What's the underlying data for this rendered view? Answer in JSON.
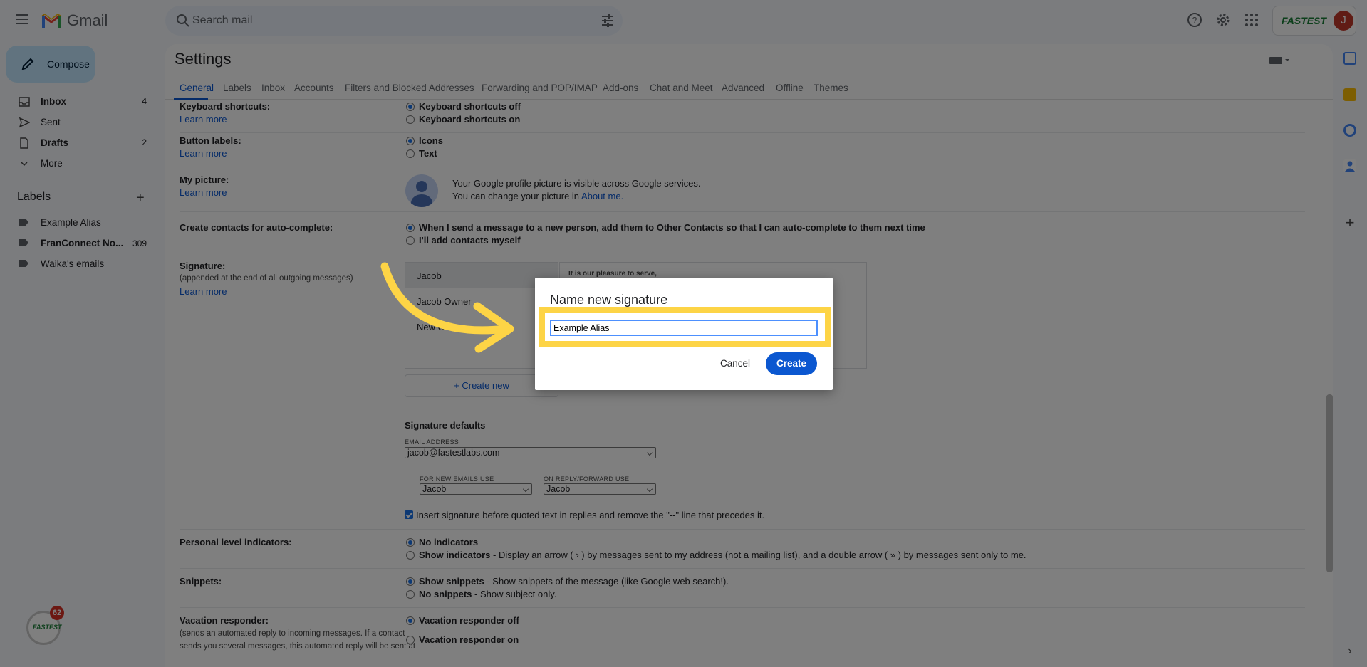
{
  "header": {
    "app_name": "Gmail",
    "search_placeholder": "Search mail",
    "brand_badge": "FASTEST"
  },
  "avatar_letter": "J",
  "nav": {
    "compose": "Compose",
    "items": [
      {
        "label": "Inbox",
        "count": "4",
        "icon": "inbox-icon"
      },
      {
        "label": "Sent",
        "count": "",
        "icon": "send-icon"
      },
      {
        "label": "Drafts",
        "count": "2",
        "icon": "draft-icon"
      },
      {
        "label": "More",
        "count": "",
        "icon": "chevron-down-icon"
      }
    ],
    "labels_header": "Labels",
    "labels": [
      {
        "label": "Example Alias",
        "count": ""
      },
      {
        "label": "FranConnect No...",
        "count": "309"
      },
      {
        "label": "Waika's emails",
        "count": ""
      }
    ],
    "float_badge_count": "62",
    "float_badge_brand": "FASTEST"
  },
  "settings": {
    "title": "Settings",
    "tabs": [
      "General",
      "Labels",
      "Inbox",
      "Accounts",
      "Filters and Blocked Addresses",
      "Forwarding and POP/IMAP",
      "Add-ons",
      "Chat and Meet",
      "Advanced",
      "Offline",
      "Themes"
    ],
    "learn_more": "Learn more",
    "keyboard": {
      "title": "Keyboard shortcuts:",
      "opt1": "Keyboard shortcuts off",
      "opt2": "Keyboard shortcuts on"
    },
    "button_labels": {
      "title": "Button labels:",
      "opt1": "Icons",
      "opt2": "Text"
    },
    "picture": {
      "title": "My picture:",
      "line1": "Your Google profile picture is visible across Google services.",
      "line2_pre": "You can change your picture in ",
      "line2_link": "About me."
    },
    "contacts": {
      "title": "Create contacts for auto-complete:",
      "opt1": "When I send a message to a new person, add them to Other Contacts so that I can auto-complete to them next time",
      "opt2": "I'll add contacts myself"
    },
    "signature": {
      "title": "Signature:",
      "sub": "(appended at the end of all outgoing messages)",
      "list": [
        "Jacob",
        "Jacob Owner",
        "New Cente"
      ],
      "editor_text": "It is our pleasure to serve,",
      "create_new": "Create new",
      "defaults_title": "Signature defaults",
      "email_address_label": "EMAIL ADDRESS",
      "email_address": "jacob@fastestlabs.com",
      "new_emails_label": "FOR NEW EMAILS USE",
      "new_emails_value": "Jacob",
      "reply_label": "ON REPLY/FORWARD USE",
      "reply_value": "Jacob",
      "insert_text": "Insert signature before quoted text in replies and remove the \"--\" line that precedes it."
    },
    "personal": {
      "title": "Personal level indicators:",
      "opt1": "No indicators",
      "opt2_b": "Show indicators",
      "opt2_rest": " - Display an arrow ( › ) by messages sent to my address (not a mailing list), and a double arrow ( » ) by messages sent only to me."
    },
    "snippets": {
      "title": "Snippets:",
      "opt1_b": "Show snippets",
      "opt1_rest": " - Show snippets of the message (like Google web search!).",
      "opt2_b": "No snippets",
      "opt2_rest": " - Show subject only."
    },
    "vacation": {
      "title": "Vacation responder:",
      "sub1": "(sends an automated reply to incoming messages. If a contact",
      "sub2": "sends you several messages, this automated reply will be sent at",
      "opt1": "Vacation responder off",
      "opt2": "Vacation responder on"
    }
  },
  "dialog": {
    "title": "Name new signature",
    "input_value": "Example Alias",
    "cancel": "Cancel",
    "create": "Create"
  },
  "colors": {
    "highlight": "#fdd446",
    "primary_button": "#0b57d0",
    "accent_link": "#0b57d0"
  }
}
